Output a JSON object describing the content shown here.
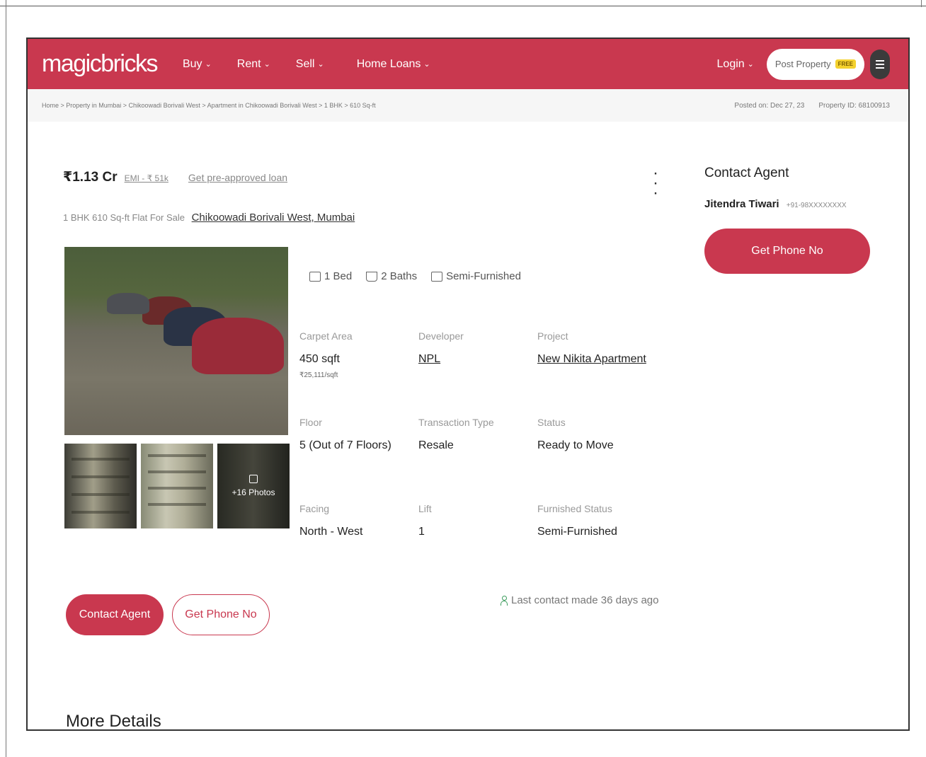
{
  "nav": {
    "logo": "magicbricks",
    "items": [
      {
        "label": "Buy"
      },
      {
        "label": "Rent"
      },
      {
        "label": "Sell"
      },
      {
        "label": "Home Loans"
      }
    ],
    "login_label": "Login",
    "post_property_label": "Post Property",
    "free_badge": "FREE",
    "chevron_icon": "chevron-down-icon",
    "menu_icon": "hamburger-menu-icon"
  },
  "breadcrumb": {
    "text": "Home > Property in Mumbai > Chikoowadi Borivali West > Apartment in Chikoowadi Borivali West > 1 BHK > 610 Sq-ft",
    "posted_on": "Posted on: Dec 27, 23",
    "property_id": "Property ID: 68100913"
  },
  "listing": {
    "price": "₹1.13 Cr",
    "emi": "EMI - ₹ 51k",
    "preapproved": "Get pre-approved loan",
    "subtitle_prefix": "1 BHK 610 Sq-ft Flat For Sale",
    "location": "Chikoowadi Borivali West, Mumbai",
    "photo_count": "+16 Photos",
    "features": [
      {
        "icon": "bed-icon",
        "label": "1 Bed"
      },
      {
        "icon": "bath-icon",
        "label": "2 Baths"
      },
      {
        "icon": "sofa-icon",
        "label": "Semi-Furnished"
      }
    ],
    "details": [
      {
        "label": "Carpet Area",
        "value": "450 sqft",
        "sub": "₹25,111/sqft"
      },
      {
        "label": "Developer",
        "value": "NPL"
      },
      {
        "label": "Project",
        "value": "New Nikita Apartment"
      },
      {
        "label": "Floor",
        "value": "5 (Out of 7 Floors)"
      },
      {
        "label": "Transaction Type",
        "value": "Resale"
      },
      {
        "label": "Status",
        "value": "Ready to Move"
      },
      {
        "label": "Facing",
        "value": "North - West"
      },
      {
        "label": "Lift",
        "value": "1"
      },
      {
        "label": "Furnished Status",
        "value": "Semi-Furnished"
      }
    ],
    "contact_agent_label": "Contact Agent",
    "get_phone_label": "Get Phone No",
    "last_contact": "Last contact made 36 days ago",
    "more_details": "More Details"
  },
  "contact_panel": {
    "title": "Contact Agent",
    "agent_name": "Jitendra Tiwari",
    "agent_phone": "+91-98XXXXXXXX",
    "button_label": "Get Phone No"
  },
  "colors": {
    "brand": "#c9384f",
    "badge": "#f4d12e"
  }
}
